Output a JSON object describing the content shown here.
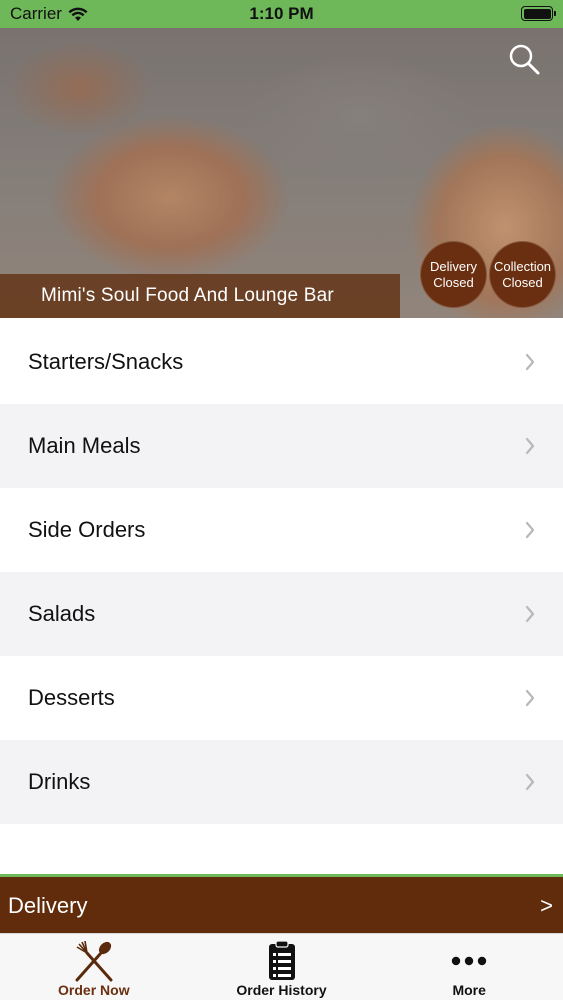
{
  "status_bar": {
    "carrier": "Carrier",
    "time": "1:10 PM"
  },
  "restaurant": {
    "name": "Mimi's Soul Food And Lounge Bar"
  },
  "delivery_status": {
    "line1": "Delivery",
    "line2": "Closed"
  },
  "collection_status": {
    "line1": "Collection",
    "line2": "Closed"
  },
  "menu": {
    "items": [
      {
        "label": "Starters/Snacks"
      },
      {
        "label": "Main Meals"
      },
      {
        "label": "Side Orders"
      },
      {
        "label": "Salads"
      },
      {
        "label": "Desserts"
      },
      {
        "label": "Drinks"
      }
    ]
  },
  "delivery_bar": {
    "label": "Delivery",
    "arrow": ">"
  },
  "tabs": [
    {
      "label": "Order Now",
      "icon": "spoon-fork-icon",
      "active": true
    },
    {
      "label": "Order History",
      "icon": "clipboard-list-icon",
      "active": false
    },
    {
      "label": "More",
      "icon": "more-dots-icon",
      "active": false
    }
  ],
  "colors": {
    "status_bar": "#6eb85a",
    "brand_brown": "#612c0b",
    "active_tab": "#6a2f10"
  }
}
